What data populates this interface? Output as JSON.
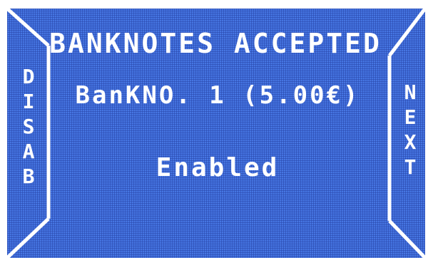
{
  "screen": {
    "title": "BANKNOTES ACCEPTED",
    "banknote_line": "BanKNO. 1 (5.00€)",
    "status": "Enabled"
  },
  "left_button": {
    "letters": [
      "D",
      "I",
      "S",
      "A",
      "B"
    ]
  },
  "right_button": {
    "letters": [
      "N",
      "E",
      "X",
      "T"
    ]
  },
  "colors": {
    "screen_background": "#4676e3",
    "grid": "#2846aa",
    "text": "#ffffff"
  }
}
